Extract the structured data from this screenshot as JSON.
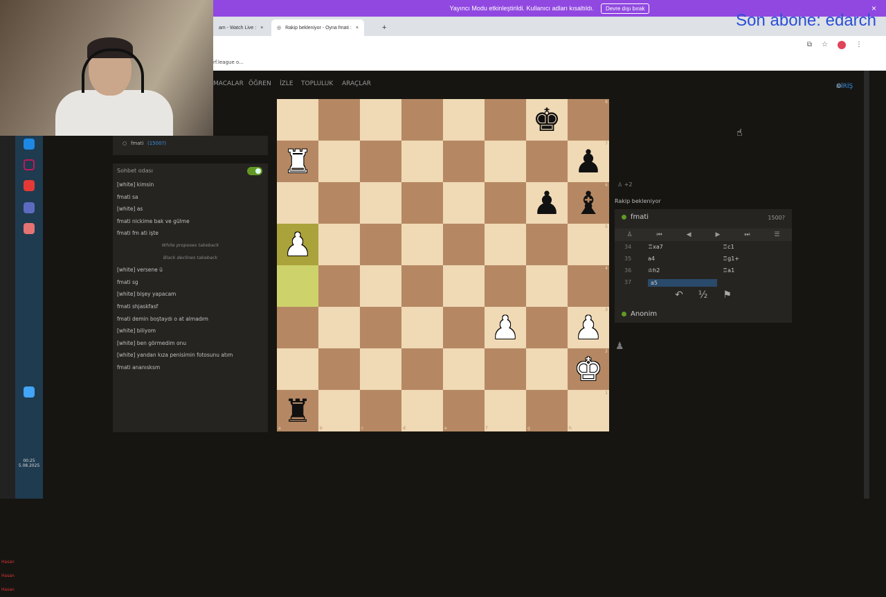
{
  "stream_banner": {
    "message": "Yayıncı Modu etkinleştirildi. Kullanıcı adları kısaltıldı.",
    "button": "Devre dışı bırak",
    "close": "×"
  },
  "browser": {
    "tabs": [
      {
        "label": "am - Watch Live :",
        "close": "×"
      },
      {
        "label": "Rakip bekleniyor - Oyna fmati :",
        "close": "×"
      }
    ],
    "new_tab": "+",
    "bookmark": "rf.league o..."
  },
  "overlay": {
    "last_subscriber": "Son abone: edarch"
  },
  "nav": {
    "items": [
      "MACALAR",
      "ÖĞREN",
      "İZLE",
      "TOPLULUK",
      "ARAÇLAR"
    ],
    "login": "GİRİŞ"
  },
  "left_player": {
    "name": "fmati",
    "rating": "(1500?)"
  },
  "chat": {
    "title": "Sohbet odası",
    "messages": [
      {
        "text": "[white] kimsin",
        "system": false
      },
      {
        "text": "fmati  sa",
        "system": false
      },
      {
        "text": "[white] as",
        "system": false
      },
      {
        "text": "fmati  nickime bak ve gülme",
        "system": false
      },
      {
        "text": "fmati  fm ati işte",
        "system": false
      },
      {
        "text": "White proposes takeback",
        "system": true
      },
      {
        "text": "Black declines takeback",
        "system": true
      },
      {
        "text": "[white] versene ü",
        "system": false
      },
      {
        "text": "fmati  sg",
        "system": false
      },
      {
        "text": "[white] bişey yapacam",
        "system": false
      },
      {
        "text": "fmati  shjaskfasf",
        "system": false
      },
      {
        "text": "fmati  demin boştaydı o at almadım",
        "system": false
      },
      {
        "text": "[white] biliyom",
        "system": false
      },
      {
        "text": "[white] ben görmedim onu",
        "system": false
      },
      {
        "text": "[white] yandan kıza penisimin fotosunu atım",
        "system": false
      },
      {
        "text": "fmati  ananısksm",
        "system": false
      }
    ]
  },
  "board": {
    "ranks": [
      [
        "",
        "",
        "",
        "",
        "",
        "",
        "bk",
        ""
      ],
      [
        "wr",
        "",
        "",
        "",
        "",
        "",
        "",
        "bp"
      ],
      [
        "",
        "",
        "",
        "",
        "",
        "",
        "bp",
        "bb"
      ],
      [
        "wp",
        "",
        "",
        "",
        "",
        "",
        "",
        ""
      ],
      [
        "",
        "",
        "",
        "",
        "",
        "",
        "",
        ""
      ],
      [
        "",
        "",
        "",
        "",
        "",
        "wp",
        "",
        "wp"
      ],
      [
        "",
        "",
        "",
        "",
        "",
        "",
        "",
        "wk"
      ],
      [
        "br",
        "",
        "",
        "",
        "",
        "",
        "",
        ""
      ]
    ],
    "highlight": [
      [
        3,
        0
      ],
      [
        4,
        0
      ]
    ],
    "file_labels": [
      "a",
      "b",
      "c",
      "d",
      "e",
      "f",
      "g",
      "h"
    ],
    "rank_labels": [
      "8",
      "7",
      "6",
      "5",
      "4",
      "3",
      "2",
      "1"
    ]
  },
  "material": "+2",
  "status": "Rakip bekleniyor",
  "top_player": {
    "name": "fmati",
    "rating": "1500?"
  },
  "bottom_player": {
    "name": "Anonim"
  },
  "moves": [
    {
      "num": "34",
      "white": "♖xa7",
      "black": "♖c1"
    },
    {
      "num": "35",
      "white": "a4",
      "black": "♖g1+"
    },
    {
      "num": "36",
      "white": "♔h2",
      "black": "♖a1"
    },
    {
      "num": "37",
      "white": "a5",
      "black": ""
    }
  ],
  "controls": [
    "♙",
    "⏮",
    "◀",
    "▶",
    "⏭",
    "☰"
  ],
  "actions": [
    "↶",
    "½",
    "⚑"
  ],
  "taskbar": {
    "time": "00:25",
    "date": "5.08.2025"
  },
  "alerts": [
    "Hasan",
    "Hasan",
    "Hasan"
  ]
}
